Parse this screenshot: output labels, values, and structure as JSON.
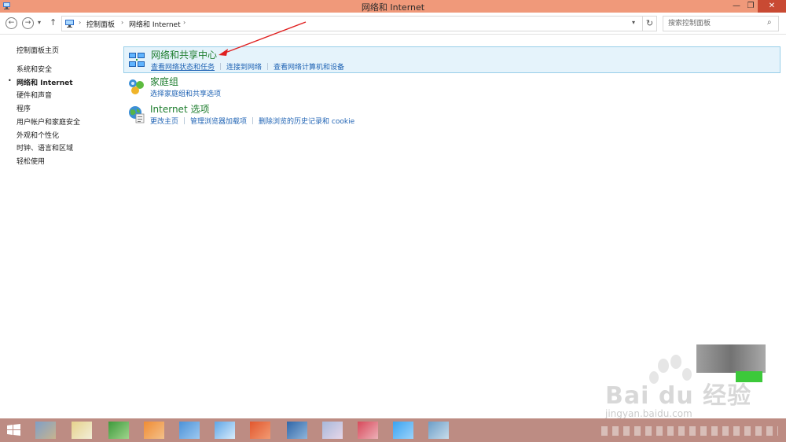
{
  "window": {
    "title": "网络和 Internet",
    "min_glyph": "—",
    "max_glyph": "❐",
    "close_glyph": "✕"
  },
  "address_bar": {
    "back_glyph": "←",
    "forward_glyph": "→",
    "dropdown_glyph": "▾",
    "up_glyph": "↑",
    "crumb_sep": "›",
    "breadcrumbs": [
      "控制面板",
      "网络和 Internet"
    ],
    "refresh_glyph": "↻",
    "search_placeholder": "搜索控制面板",
    "search_glyph": "⌕"
  },
  "sidebar": {
    "home": "控制面板主页",
    "bullet": "•",
    "items": [
      {
        "label": "系统和安全",
        "active": false
      },
      {
        "label": "网络和 Internet",
        "active": true
      },
      {
        "label": "硬件和声音",
        "active": false
      },
      {
        "label": "程序",
        "active": false
      },
      {
        "label": "用户帐户和家庭安全",
        "active": false
      },
      {
        "label": "外观和个性化",
        "active": false
      },
      {
        "label": "时钟、语言和区域",
        "active": false
      },
      {
        "label": "轻松使用",
        "active": false
      }
    ]
  },
  "categories": [
    {
      "title": "网络和共享中心",
      "icon": "network-sharing-center-icon",
      "selected": true,
      "links": [
        "查看网络状态和任务",
        "连接到网络",
        "查看网络计算机和设备"
      ]
    },
    {
      "title": "家庭组",
      "icon": "homegroup-icon",
      "selected": false,
      "links": [
        "选择家庭组和共享选项"
      ]
    },
    {
      "title": "Internet 选项",
      "icon": "internet-options-icon",
      "selected": false,
      "links": [
        "更改主页",
        "管理浏览器加载项",
        "删除浏览的历史记录和 cookie"
      ]
    }
  ],
  "watermark": {
    "brand": "Bai du 经验",
    "url": "jingyan.baidu.com"
  },
  "colors": {
    "titlebar": "#f0997a",
    "link": "#1f63b4",
    "category_title": "#1f7e2f",
    "selection_bg": "#e5f3fb",
    "selection_border": "#99cfe9",
    "annotation_arrow": "#e02020",
    "taskbar": "#bd8c83"
  }
}
